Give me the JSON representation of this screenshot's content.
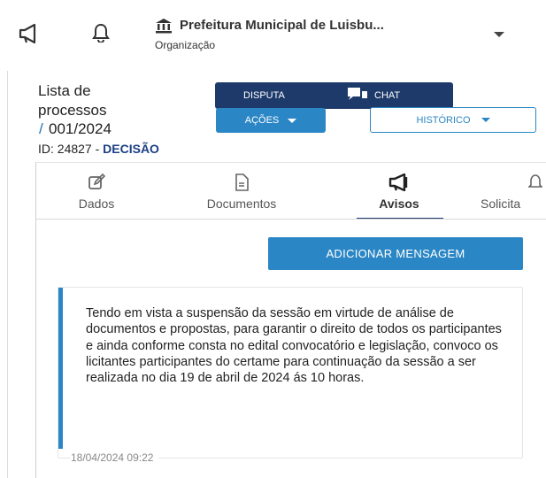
{
  "topbar": {
    "organization_name": "Prefeitura Municipal de Luisbu...",
    "organization_label": "Organização",
    "icons": [
      "megaphone-icon",
      "bell-icon",
      "bank-icon",
      "chevron-down-icon"
    ]
  },
  "process": {
    "list_label": "Lista de processos",
    "slash": "/",
    "number": "001/2024",
    "id_prefix": "ID: 24827 - ",
    "status": "DECISÃO"
  },
  "actions": {
    "disputa": "DISPUTA",
    "chat": "CHAT",
    "acoes": "AÇÕES",
    "historico": "HISTÓRICO"
  },
  "tabs": [
    {
      "label": "Dados",
      "icon": "edit-icon"
    },
    {
      "label": "Documentos",
      "icon": "document-icon"
    },
    {
      "label": "Avisos",
      "icon": "megaphone-icon",
      "active": true
    },
    {
      "label": "Solicita",
      "icon": "bell-icon"
    }
  ],
  "avisos": {
    "add_button": "ADICIONAR MENSAGEM",
    "messages": [
      {
        "text": "Tendo em vista a suspensão da sessão em virtude de análise de documentos e propostas, para garantir o direito de todos os participantes e ainda conforme consta no edital convocatório e legislação, convoco os licitantes participantes do certame para continuação da sessão a ser realizada no dia 19 de abril de 2024 ás 10 horas.",
        "timestamp": "18/04/2024 09:22"
      }
    ]
  },
  "colors": {
    "primary": "#2b86c5",
    "dark": "#1e3a6b",
    "status": "#1b3f86"
  }
}
